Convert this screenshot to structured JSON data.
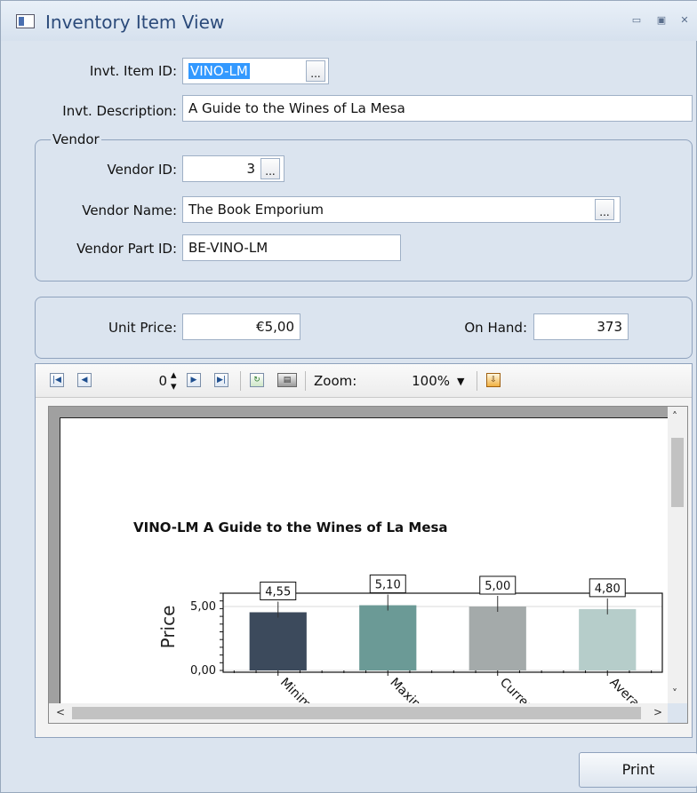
{
  "window": {
    "title": "Inventory Item View"
  },
  "item": {
    "id_label": "Invt. Item ID:",
    "id_value": "VINO-LM",
    "description_label": "Invt. Description:",
    "description_value": "A Guide to the Wines of La Mesa"
  },
  "vendor": {
    "group_label": "Vendor",
    "id_label": "Vendor ID:",
    "id_value": "3",
    "name_label": "Vendor Name:",
    "name_value": "The Book Emporium",
    "part_label": "Vendor Part ID:",
    "part_value": "BE-VINO-LM"
  },
  "pricing": {
    "unit_price_label": "Unit Price:",
    "unit_price_value": "€5,00",
    "on_hand_label": "On Hand:",
    "on_hand_value": "373"
  },
  "toolbar": {
    "page_value": "0",
    "zoom_label": "Zoom:",
    "zoom_value": "100%",
    "ellipsis": "..."
  },
  "chart_data": {
    "type": "bar",
    "title": "VINO-LM A Guide to the Wines of La Mesa",
    "ylabel": "Price",
    "categories": [
      "Minim",
      "Maxim",
      "Curren",
      "Averag"
    ],
    "values": [
      4.55,
      5.1,
      5.0,
      4.8
    ],
    "data_labels": [
      "4,55",
      "5,10",
      "5,00",
      "4,80"
    ],
    "y_ticks": [
      "5,00",
      "0,00"
    ],
    "colors": [
      "#3c4a5c",
      "#6b9a96",
      "#a4aaaa",
      "#b6cdca"
    ],
    "ylim": [
      0,
      5.6
    ]
  },
  "footer": {
    "print_label": "Print"
  }
}
